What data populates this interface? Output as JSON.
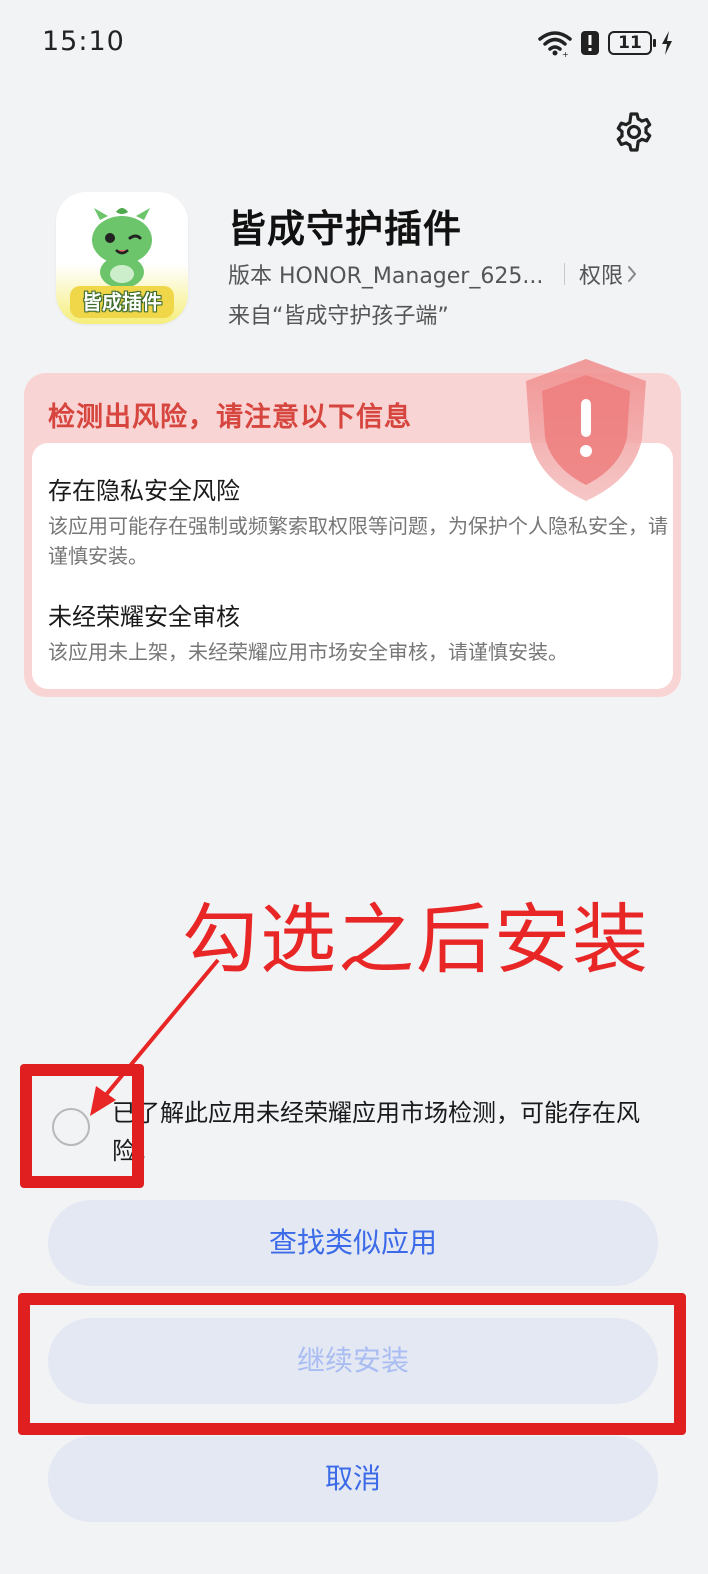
{
  "status_bar": {
    "time": "15:10",
    "battery": "11",
    "icons": [
      "wifi-icon",
      "alert-icon",
      "battery-icon",
      "charging-icon"
    ]
  },
  "header": {
    "settings_icon": "gear-icon"
  },
  "app": {
    "icon_label": "皆成插件",
    "title": "皆成守护插件",
    "version": "版本 HONOR_Manager_625...",
    "permissions_label": "权限",
    "source": "来自“皆成守护孩子端”"
  },
  "risk": {
    "header": "检测出风险，请注意以下信息",
    "items": [
      {
        "title": "存在隐私安全风险",
        "desc": "该应用可能存在强制或频繁索取权限等问题，为保护个人隐私安全，请谨慎安装。"
      },
      {
        "title": "未经荣耀安全审核",
        "desc": "该应用未上架，未经荣耀应用市场安全审核，请谨慎安装。"
      }
    ],
    "colors": {
      "accent": "#d6463f",
      "background": "#f9d4d4"
    }
  },
  "annotation": {
    "text": "勾选之后安装",
    "color": "#e82626"
  },
  "acknowledge": {
    "checked": false,
    "text": "已了解此应用未经荣耀应用市场检测，可能存在风险。"
  },
  "buttons": {
    "find_similar": "查找类似应用",
    "continue_install": "继续安装",
    "cancel": "取消",
    "primary_color": "#3b6be8"
  }
}
